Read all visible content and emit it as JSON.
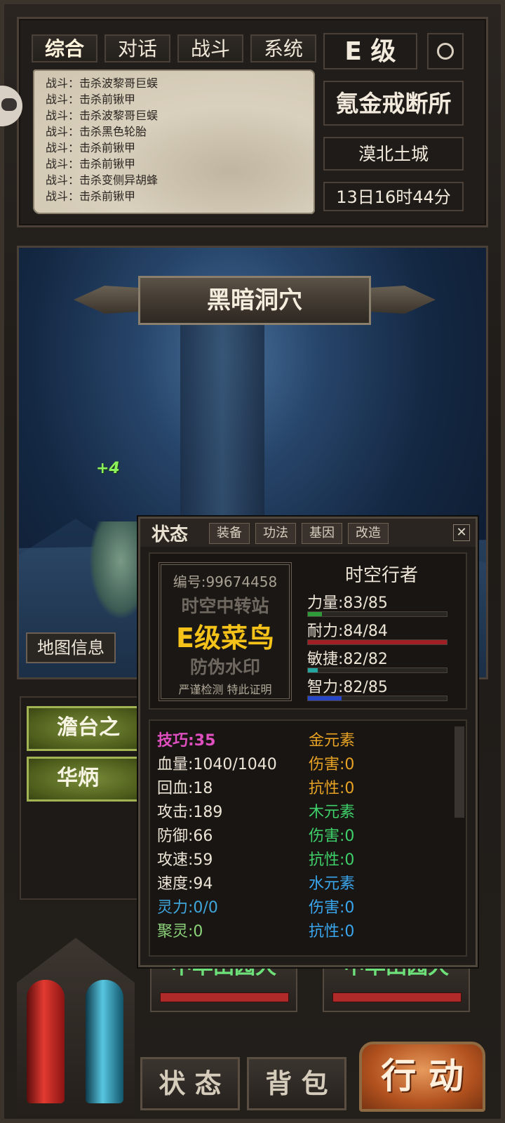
{
  "top": {
    "tabs": [
      "综合",
      "对话",
      "战斗",
      "系统"
    ],
    "grade": "E 级",
    "guild": "氪金戒断所",
    "location": "漠北土城",
    "time": "13日16时44分",
    "log": [
      "战斗：击杀波黎哥巨蜈",
      "战斗：击杀前锹甲",
      "战斗：击杀波黎哥巨蜈",
      "战斗：击杀黑色轮胎",
      "战斗：击杀前锹甲",
      "战斗：击杀前锹甲",
      "战斗：击杀变侧异胡蜂",
      "战斗：击杀前锹甲"
    ]
  },
  "scene": {
    "title": "黑暗洞穴",
    "floating_text": "+4",
    "map_info": "地图信息"
  },
  "list": {
    "items": [
      "澹台之",
      "华炳"
    ]
  },
  "bottom": {
    "cards": [
      "中华田园犬",
      "中华田园犬"
    ],
    "status_btn": "状 态",
    "bag_btn": "背 包",
    "action_btn": "行 动",
    "colors": {
      "hp": "#e23a30",
      "mp": "#57c6e0",
      "card_title": "#6ee07a"
    }
  },
  "dialog": {
    "title": "状态",
    "tabs": [
      "装备",
      "功法",
      "基因",
      "改造"
    ],
    "close": "✕",
    "badge": {
      "id": "编号:99674458",
      "line1": "时空中转站",
      "line2": "E级菜鸟",
      "line3": "防伪水印",
      "line4": "严谨检测 特此证明"
    },
    "char_name": "时空行者",
    "attributes": [
      {
        "label": "力量:83/85",
        "value": 83,
        "max": 85,
        "color": "#2e9a3a",
        "fill": 0.1
      },
      {
        "label": "耐力:84/84",
        "value": 84,
        "max": 84,
        "color": "#a01f24",
        "fill": 1.0
      },
      {
        "label": "敏捷:82/82",
        "value": 82,
        "max": 82,
        "color": "#21a7a0",
        "fill": 0.07
      },
      {
        "label": "智力:82/85",
        "value": 82,
        "max": 85,
        "color": "#2746c8",
        "fill": 0.24
      }
    ],
    "stats_left": [
      {
        "text": "技巧:35",
        "color": "#e04fbf"
      },
      {
        "text": "血量:1040/1040",
        "color": "#ece4d6"
      },
      {
        "text": "回血:18",
        "color": "#ece4d6"
      },
      {
        "text": "攻击:189",
        "color": "#ece4d6"
      },
      {
        "text": "防御:66",
        "color": "#ece4d6"
      },
      {
        "text": "攻速:59",
        "color": "#ece4d6"
      },
      {
        "text": "速度:94",
        "color": "#ece4d6"
      },
      {
        "text": "灵力:0/0",
        "color": "#3fa6dc"
      },
      {
        "text": "聚灵:0",
        "color": "#8cd47a"
      }
    ],
    "stats_right": [
      {
        "text": "金元素",
        "color": "#e8a325"
      },
      {
        "text": "伤害:0",
        "color": "#e8a325"
      },
      {
        "text": "抗性:0",
        "color": "#e8a325"
      },
      {
        "text": "木元素",
        "color": "#3fd06a"
      },
      {
        "text": "伤害:0",
        "color": "#3fd06a"
      },
      {
        "text": "抗性:0",
        "color": "#3fd06a"
      },
      {
        "text": "水元素",
        "color": "#3aa6ee"
      },
      {
        "text": "伤害:0",
        "color": "#3aa6ee"
      },
      {
        "text": "抗性:0",
        "color": "#3aa6ee"
      }
    ]
  }
}
